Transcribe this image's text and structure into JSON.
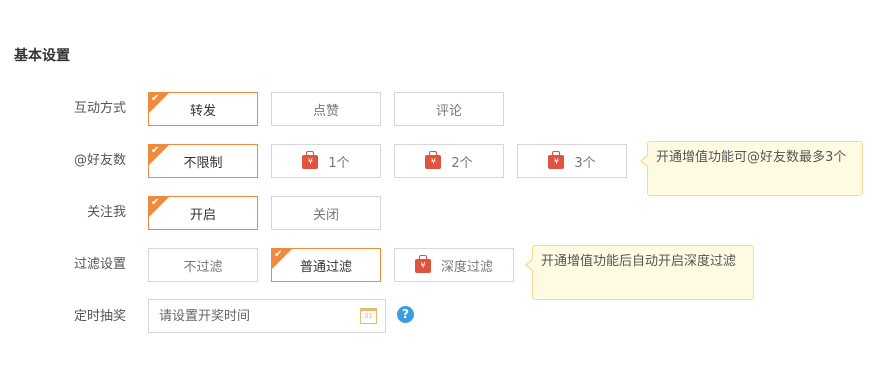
{
  "section_title": "基本设置",
  "icons": {
    "check": "check-icon",
    "premium": "premium-bag-icon",
    "calendar": "calendar-icon",
    "help": "help-icon",
    "currency_glyph": "¥",
    "calendar_glyph": "31"
  },
  "colors": {
    "accent": "#f08a3c",
    "premium_bag": "#e0533f",
    "help": "#3d9de0",
    "tip_bg": "#fffbe3"
  },
  "interaction": {
    "label": "互动方式",
    "options": [
      {
        "label": "转发",
        "selected": true
      },
      {
        "label": "点赞",
        "selected": false
      },
      {
        "label": "评论",
        "selected": false
      }
    ]
  },
  "friends": {
    "label": "@好友数",
    "options": [
      {
        "label": "不限制",
        "selected": true,
        "premium": false
      },
      {
        "label": "1个",
        "selected": false,
        "premium": true
      },
      {
        "label": "2个",
        "selected": false,
        "premium": true
      },
      {
        "label": "3个",
        "selected": false,
        "premium": true
      }
    ],
    "tip": "开通增值功能可@好友数最多3个"
  },
  "follow": {
    "label": "关注我",
    "options": [
      {
        "label": "开启",
        "selected": true
      },
      {
        "label": "关闭",
        "selected": false
      }
    ]
  },
  "filter": {
    "label": "过滤设置",
    "options": [
      {
        "label": "不过滤",
        "selected": false,
        "premium": false
      },
      {
        "label": "普通过滤",
        "selected": true,
        "premium": false
      },
      {
        "label": "深度过滤",
        "selected": false,
        "premium": true
      }
    ],
    "tip": "开通增值功能后自动开启深度过滤"
  },
  "draw": {
    "label": "定时抽奖",
    "placeholder": "请设置开奖时间",
    "help_glyph": "?"
  }
}
